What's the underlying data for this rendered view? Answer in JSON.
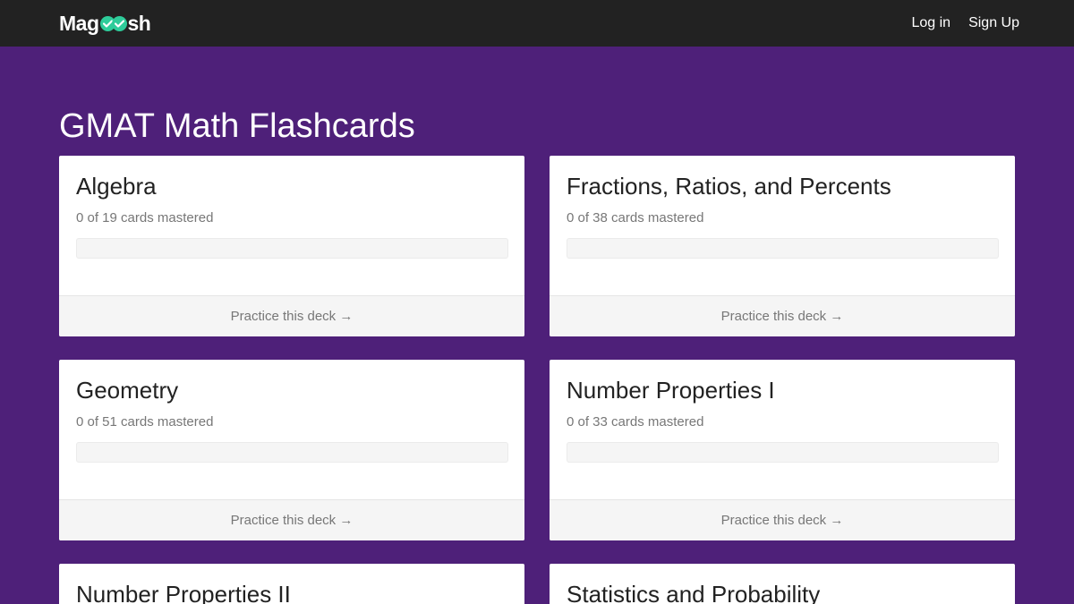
{
  "header": {
    "logo": {
      "left": "Mag",
      "right": "sh"
    },
    "login_label": "Log in",
    "signup_label": "Sign Up"
  },
  "page": {
    "title": "GMAT Math Flashcards"
  },
  "decks": [
    {
      "title": "Algebra",
      "mastered_text": "0 of 19 cards mastered",
      "progress": 0,
      "cta": "Practice this deck →"
    },
    {
      "title": "Fractions, Ratios, and Percents",
      "mastered_text": "0 of 38 cards mastered",
      "progress": 0,
      "cta": "Practice this deck →"
    },
    {
      "title": "Geometry",
      "mastered_text": "0 of 51 cards mastered",
      "progress": 0,
      "cta": "Practice this deck →"
    },
    {
      "title": "Number Properties I",
      "mastered_text": "0 of 33 cards mastered",
      "progress": 0,
      "cta": "Practice this deck →"
    },
    {
      "title": "Number Properties II"
    },
    {
      "title": "Statistics and Probability"
    }
  ],
  "colors": {
    "background": "#4e2079",
    "navbar": "#222222",
    "brand_green": "#2ecc9a"
  },
  "icons": {
    "logo_mark": "double-check-icon",
    "arrow": "right-arrow"
  }
}
